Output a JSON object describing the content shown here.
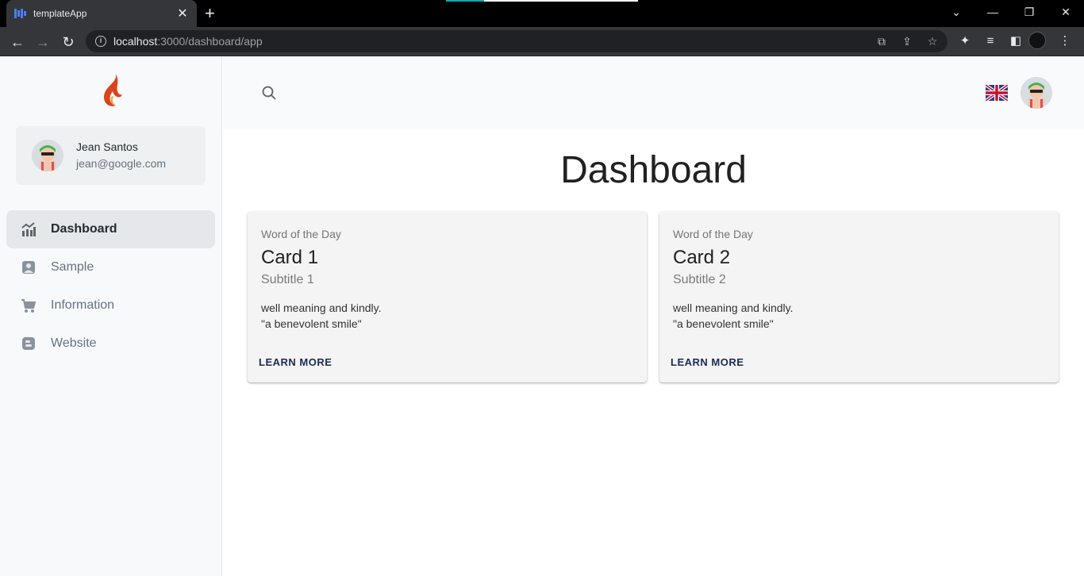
{
  "browser": {
    "tab_title": "templateApp",
    "url_host": "localhost",
    "url_rest": ":3000/dashboard/app"
  },
  "sidebar": {
    "user": {
      "name": "Jean Santos",
      "email": "jean@google.com"
    },
    "items": [
      {
        "label": "Dashboard",
        "icon": "chart-icon",
        "active": true
      },
      {
        "label": "Sample",
        "icon": "user-icon",
        "active": false
      },
      {
        "label": "Information",
        "icon": "cart-icon",
        "active": false
      },
      {
        "label": "Website",
        "icon": "blog-icon",
        "active": false
      }
    ]
  },
  "main": {
    "title": "Dashboard",
    "cards": [
      {
        "overline": "Word of the Day",
        "title": "Card 1",
        "subtitle": "Subtitle 1",
        "body_line1": "well meaning and kindly.",
        "body_line2": "\"a benevolent smile\"",
        "action": "LEARN MORE"
      },
      {
        "overline": "Word of the Day",
        "title": "Card 2",
        "subtitle": "Subtitle 2",
        "body_line1": "well meaning and kindly.",
        "body_line2": "\"a benevolent smile\"",
        "action": "LEARN MORE"
      }
    ]
  },
  "colors": {
    "accent": "#1c2a55",
    "sidebar_bg": "#f8f9fb",
    "active_item_bg": "#e5e7ea"
  }
}
